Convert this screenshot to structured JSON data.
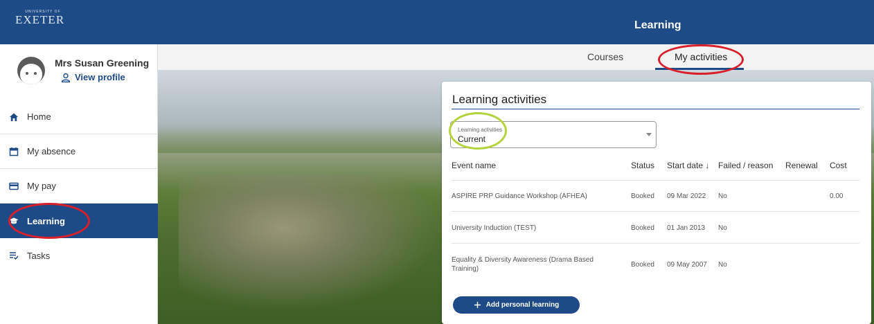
{
  "header": {
    "logo_top": "UNIVERSITY OF",
    "logo_main": "EXETER",
    "title": "Learning"
  },
  "user": {
    "name": "Mrs Susan Greening",
    "view_profile": "View profile"
  },
  "nav": [
    {
      "label": "Home",
      "icon": "home-icon"
    },
    {
      "label": "My absence",
      "icon": "calendar-icon"
    },
    {
      "label": "My pay",
      "icon": "card-icon"
    },
    {
      "label": "Learning",
      "icon": "graduation-cap-icon",
      "active": true
    },
    {
      "label": "Tasks",
      "icon": "checklist-icon"
    }
  ],
  "tabs": [
    "Courses",
    "My activities"
  ],
  "panel": {
    "title": "Learning activities",
    "filter": {
      "label": "Learning activities",
      "value": "Current"
    },
    "columns": [
      "Event name",
      "Status",
      "Start date",
      "Failed / reason",
      "Renewal",
      "Cost"
    ],
    "rows": [
      {
        "event": "ASPIRE PRP Guidance Workshop (AFHEA)",
        "status": "Booked",
        "start": "09 Mar 2022",
        "failed": "No",
        "renewal": "",
        "cost": "0.00"
      },
      {
        "event": "University Induction (TEST)",
        "status": "Booked",
        "start": "01 Jan 2013",
        "failed": "No",
        "renewal": "",
        "cost": ""
      },
      {
        "event_line1": "Equality & Diversity Awareness (Drama Based",
        "event_line2": "Training)",
        "status": "Booked",
        "start": "09 May 2007",
        "failed": "No",
        "renewal": "",
        "cost": ""
      }
    ],
    "add_button": "Add personal learning"
  },
  "colors": {
    "brand": "#1e4a87",
    "annotation_red": "#d81f2a",
    "annotation_green": "#b4d33c"
  }
}
